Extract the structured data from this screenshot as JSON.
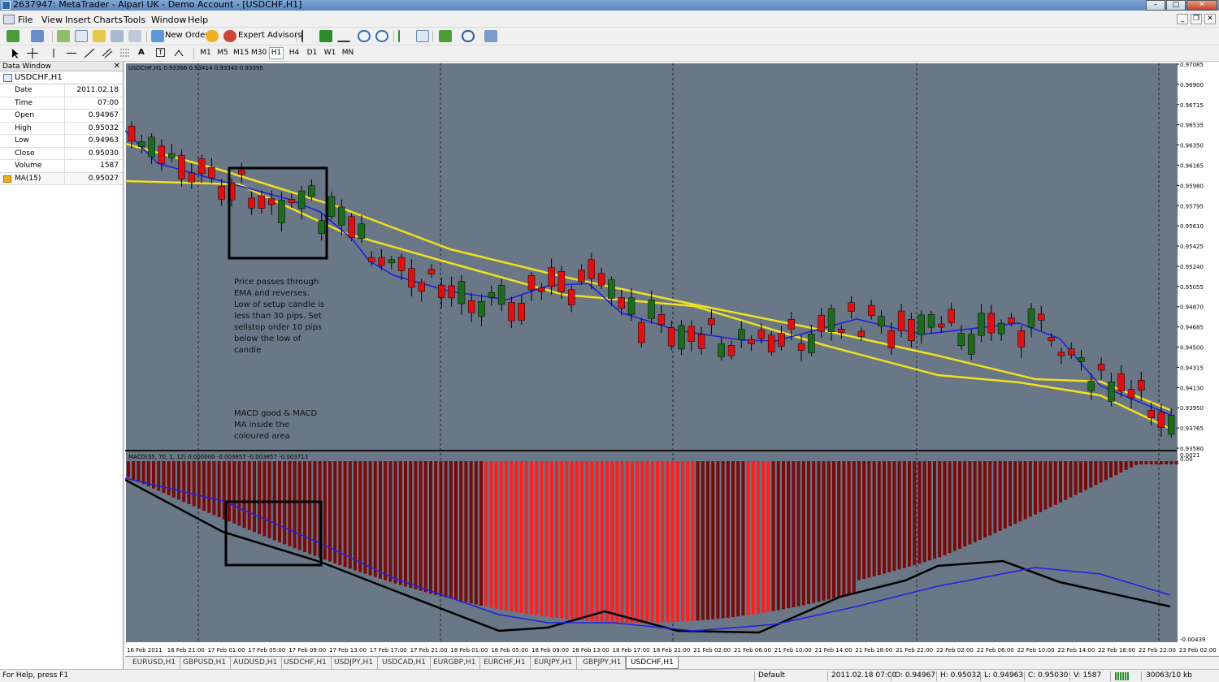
{
  "window": {
    "title": "2637947: MetaTrader - Alpari UK - Demo Account - [USDCHF,H1]"
  },
  "menu": [
    "File",
    "View",
    "Insert",
    "Charts",
    "Tools",
    "Window",
    "Help"
  ],
  "toolbar": {
    "new_order": "New Order",
    "expert_advisors": "Expert Advisors",
    "timeframes": [
      "M1",
      "M5",
      "M15",
      "M30",
      "H1",
      "H4",
      "D1",
      "W1",
      "MN"
    ],
    "active_timeframe": "H1",
    "text_tool": "A",
    "label_tool": "T"
  },
  "data_window": {
    "title": "Data Window",
    "symbol": "USDCHF,H1",
    "rows": [
      {
        "label": "Date",
        "value": "2011.02.18"
      },
      {
        "label": "Time",
        "value": "07:00"
      },
      {
        "label": "Open",
        "value": "0.94967"
      },
      {
        "label": "High",
        "value": "0.95032"
      },
      {
        "label": "Low",
        "value": "0.94963"
      },
      {
        "label": "Close",
        "value": "0.95030"
      },
      {
        "label": "Volume",
        "value": "1587"
      },
      {
        "label": "MA(15)",
        "value": "0.95027"
      }
    ]
  },
  "chart": {
    "header": "USDCHF,H1  0.93366 0.93414 0.93340 0.93395",
    "macd_header": "MACD(35, 70, 1, 12) 0.000000 -0.003857 -0.003857 -0.003713",
    "price_ticks": [
      "0.97085",
      "0.96900",
      "0.96715",
      "0.96535",
      "0.96350",
      "0.96165",
      "0.95980",
      "0.95795",
      "0.95610",
      "0.95425",
      "0.95240",
      "0.95055",
      "0.94870",
      "0.94685",
      "0.94500",
      "0.94315",
      "0.94130",
      "0.93950",
      "0.93765",
      "0.93580"
    ],
    "macd_ticks": [
      "0.0021",
      "0.00",
      "-0.00439"
    ],
    "time_labels": [
      "16 Feb 2011",
      "16 Feb 21:00",
      "17 Feb 01:00",
      "17 Feb 05:00",
      "17 Feb 09:00",
      "17 Feb 13:00",
      "17 Feb 17:00",
      "17 Feb 21:00",
      "18 Feb 01:00",
      "18 Feb 05:00",
      "18 Feb 09:00",
      "18 Feb 13:00",
      "18 Feb 17:00",
      "18 Feb 21:00",
      "21 Feb 02:00",
      "21 Feb 06:00",
      "21 Feb 10:00",
      "21 Feb 14:00",
      "21 Feb 18:00",
      "21 Feb 22:00",
      "22 Feb 02:00",
      "22 Feb 06:00",
      "22 Feb 10:00",
      "22 Feb 14:00",
      "22 Feb 18:00",
      "22 Feb 22:00",
      "23 Feb 02:00"
    ],
    "annotation_1": [
      "Price passes through",
      "EMA and reverses.",
      "Low of setup candle is",
      "less than 30 pips. Set",
      "sellstop order 10 pips",
      "below the low of",
      "candle"
    ],
    "annotation_2": [
      "MACD good & MACD",
      "MA  inside the",
      "coloured area"
    ],
    "colors": {
      "bg": "#6a7787",
      "bull": "#1e6b1e",
      "bear": "#e01010",
      "ema": "#2020e0",
      "band": "#f0e020",
      "macd_hist_dark": "#7a0a0a",
      "macd_hist_bright": "#ff1e1e"
    }
  },
  "tabs": [
    "EURUSD,H1",
    "GBPUSD,H1",
    "AUDUSD,H1",
    "USDCHF,H1",
    "USDJPY,H1",
    "USDCAD,H1",
    "EURGBP,H1",
    "EURCHF,H1",
    "EURJPY,H1",
    "GBPJPY,H1",
    "USDCHF,H1"
  ],
  "active_tab_index": 10,
  "status": {
    "help": "For Help, press F1",
    "profile": "Default",
    "datetime": "2011.02.18 07:00",
    "open": "O: 0.94967",
    "high": "H: 0.95032",
    "low": "L: 0.94963",
    "close": "C: 0.95030",
    "volume": "V: 1587",
    "traffic": "30063/10 kb"
  }
}
